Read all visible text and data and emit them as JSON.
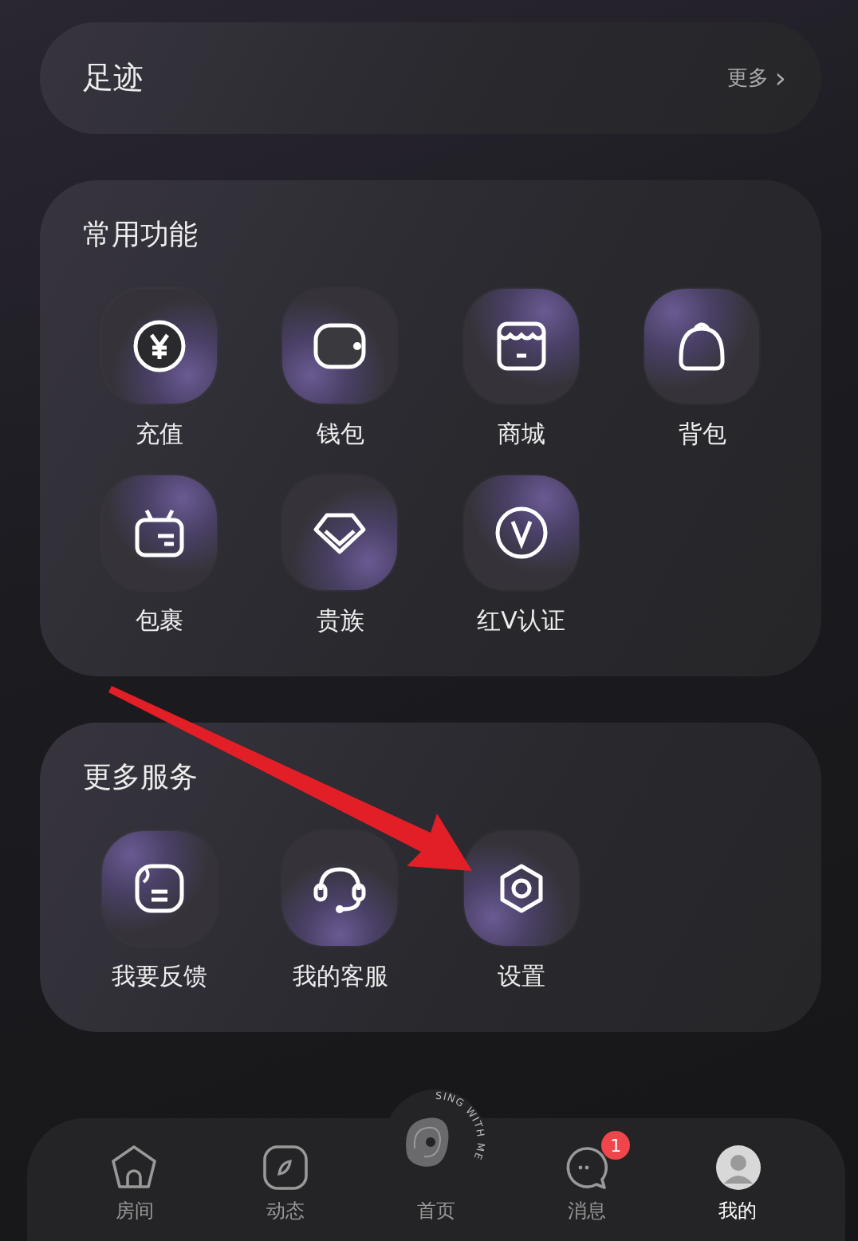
{
  "footprint": {
    "title": "足迹",
    "more": "更多",
    "chevron": "›"
  },
  "common": {
    "title": "常用功能",
    "items": [
      {
        "label": "充值",
        "kind": "yuan"
      },
      {
        "label": "钱包",
        "kind": "wallet"
      },
      {
        "label": "商城",
        "kind": "store"
      },
      {
        "label": "背包",
        "kind": "backpack"
      },
      {
        "label": "包裹",
        "kind": "parcel"
      },
      {
        "label": "贵族",
        "kind": "gem"
      },
      {
        "label": "红V认证",
        "kind": "vbadge"
      }
    ]
  },
  "services": {
    "title": "更多服务",
    "items": [
      {
        "label": "我要反馈",
        "kind": "feedback"
      },
      {
        "label": "我的客服",
        "kind": "headset"
      },
      {
        "label": "设置",
        "kind": "settings"
      }
    ]
  },
  "tabbar": {
    "center_caption": "SING WITH ME",
    "tabs": [
      {
        "label": "房间",
        "kind": "house",
        "selected": false
      },
      {
        "label": "动态",
        "kind": "compass",
        "selected": false
      },
      {
        "label": "首页",
        "kind": "disc",
        "selected": false
      },
      {
        "label": "消息",
        "kind": "chat",
        "selected": false,
        "badge": "1"
      },
      {
        "label": "我的",
        "kind": "avatar",
        "selected": true
      }
    ]
  }
}
